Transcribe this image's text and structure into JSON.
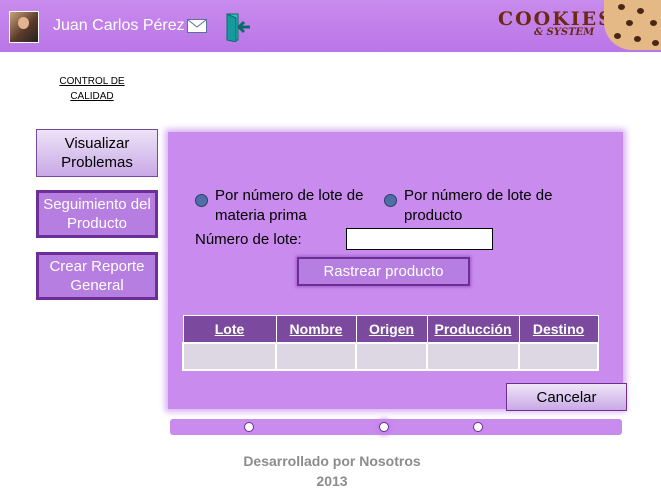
{
  "header": {
    "username": "Juan Carlos Pérez",
    "logo_main": "COOKIES",
    "logo_sub": "& SYSTEM",
    "icons": [
      "user-avatar",
      "mail-icon",
      "exit-icon",
      "cookie-image"
    ]
  },
  "section_title": "CONTROL DE CALIDAD",
  "sidebar": {
    "items": [
      {
        "label": "Visualizar Problemas"
      },
      {
        "label": "Seguimiento del Producto"
      },
      {
        "label": "Crear Reporte General"
      }
    ]
  },
  "form": {
    "radio_materia": "Por número de lote de materia prima",
    "radio_producto": "Por número de lote de producto",
    "lote_label": "Número de lote:",
    "lote_value": "",
    "rastrear_label": "Rastrear producto"
  },
  "table": {
    "columns": [
      "Lote",
      "Nombre",
      "Origen",
      "Producción",
      "Destino"
    ],
    "rows": [
      [
        "",
        "",
        "",
        "",
        ""
      ]
    ]
  },
  "cancel_label": "Cancelar",
  "footer": {
    "line1": "Desarrollado por Nosotros",
    "line2": "2013"
  },
  "colors": {
    "accent": "#c98bee",
    "dark_purple": "#6d2f96",
    "table_header": "#7b4a9e"
  }
}
